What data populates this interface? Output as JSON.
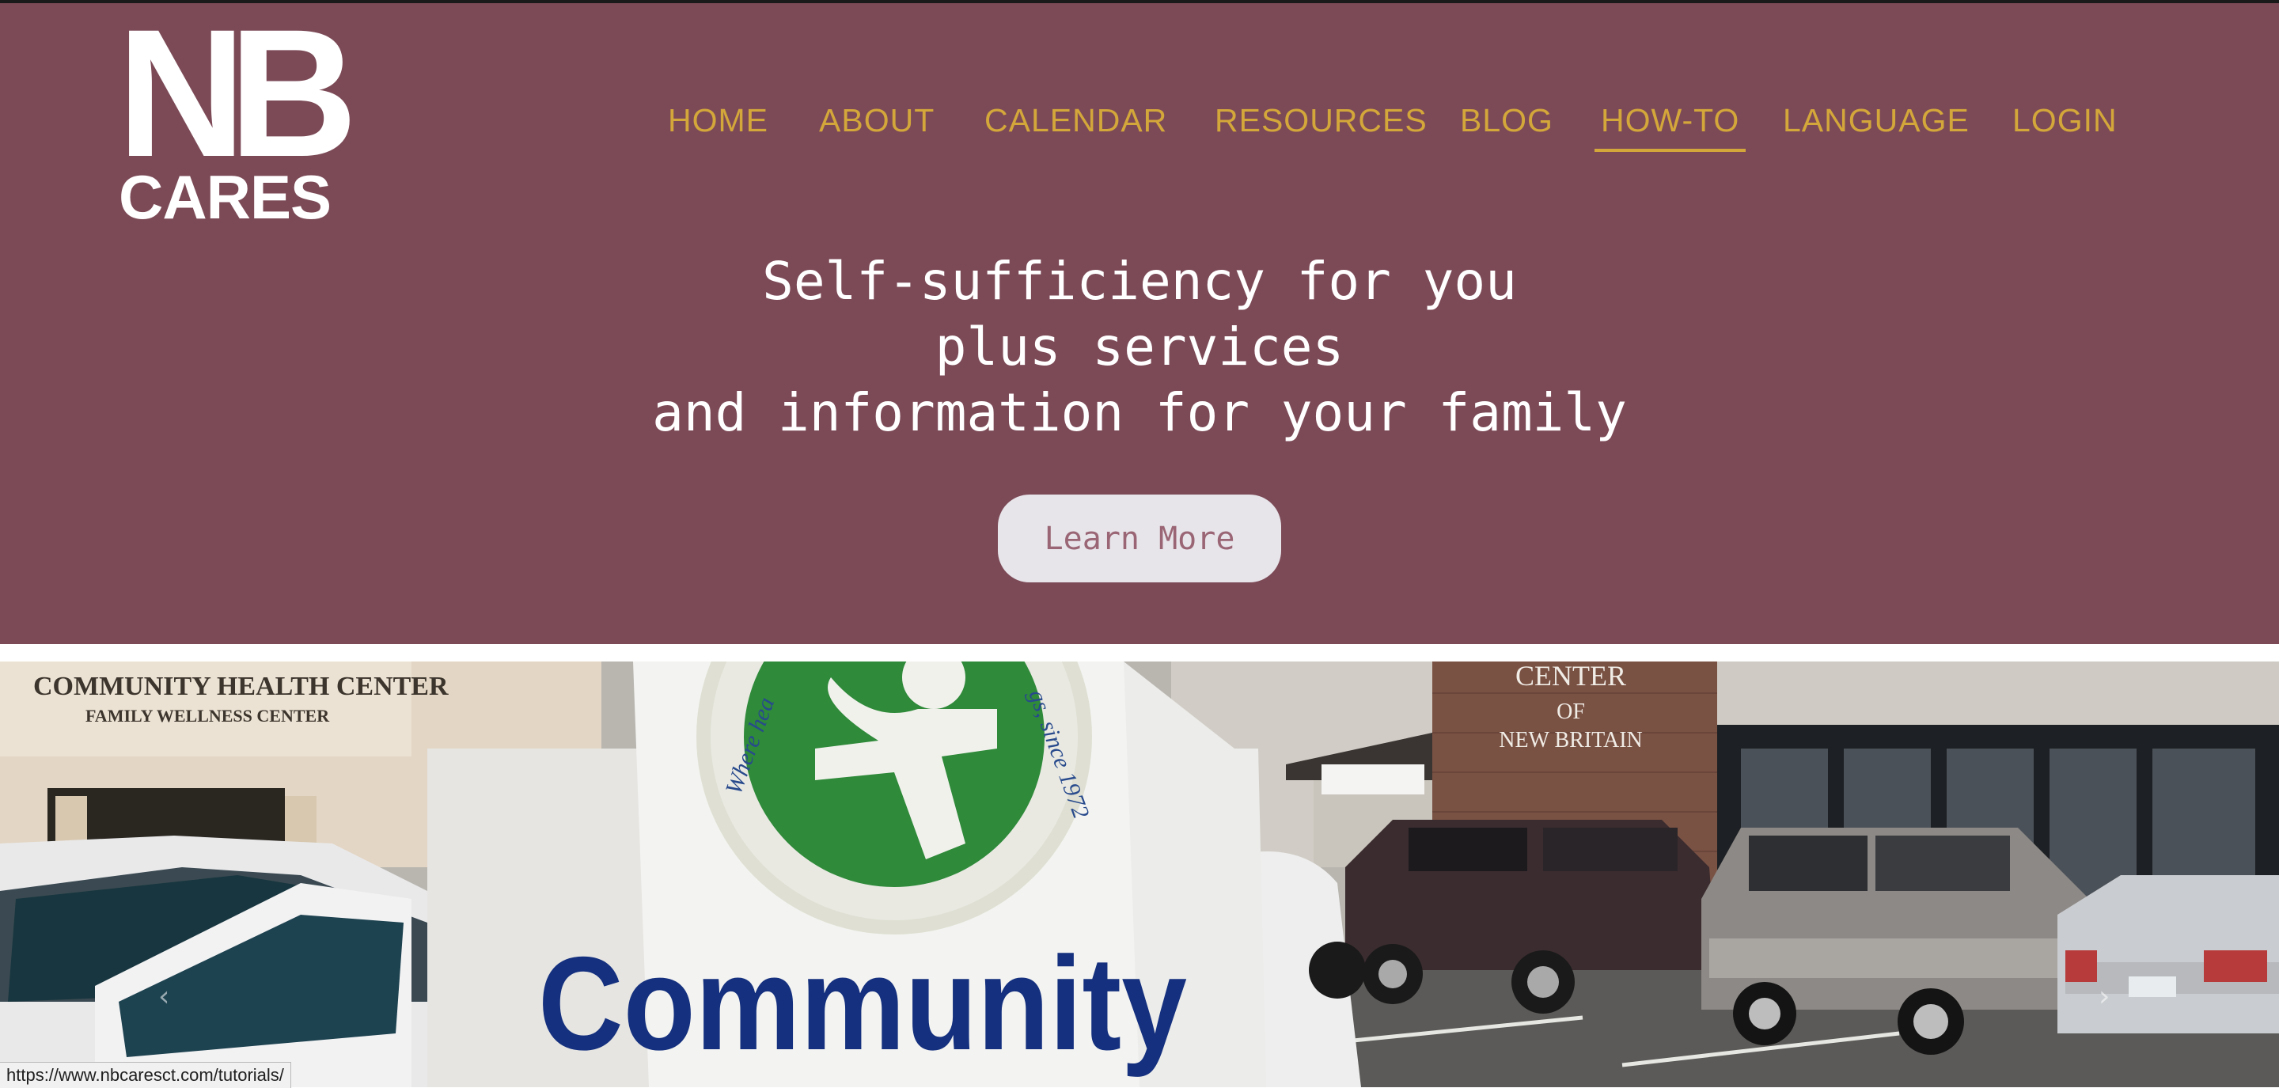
{
  "logo": {
    "line1": "NB",
    "line2": "CARES"
  },
  "nav": {
    "items": [
      {
        "label": "HOME"
      },
      {
        "label": "ABOUT"
      },
      {
        "label": "CALENDAR"
      },
      {
        "label": "RESOURCES"
      },
      {
        "label": "BLOG"
      },
      {
        "label": "HOW-TO"
      },
      {
        "label": "LANGUAGE"
      },
      {
        "label": "LOGIN"
      }
    ],
    "active": "HOW-TO"
  },
  "hero": {
    "lines": [
      "Self-sufficiency for you",
      "plus services",
      "and information for your family"
    ],
    "button_label": "Learn More"
  },
  "photo": {
    "building_sign_line1": "COMMUNITY HEALTH CENTER",
    "building_sign_line2": "FAMILY WELLNESS CENTER",
    "center_sign_line1": "CENTER",
    "center_sign_line2": "OF",
    "center_sign_line3": "NEW BRITAIN",
    "monument_word": "Community",
    "ring_left": "Where hea",
    "ring_right": "gs, since 1972"
  },
  "slider": {
    "prev": "‹",
    "next": "›"
  },
  "status_bar": {
    "url": "https://www.nbcaresct.com/tutorials/"
  },
  "colors": {
    "header_bg": "#7c4a57",
    "nav_text": "#d4a73a",
    "button_bg": "#e7e5ea",
    "button_text": "#9a6675"
  }
}
